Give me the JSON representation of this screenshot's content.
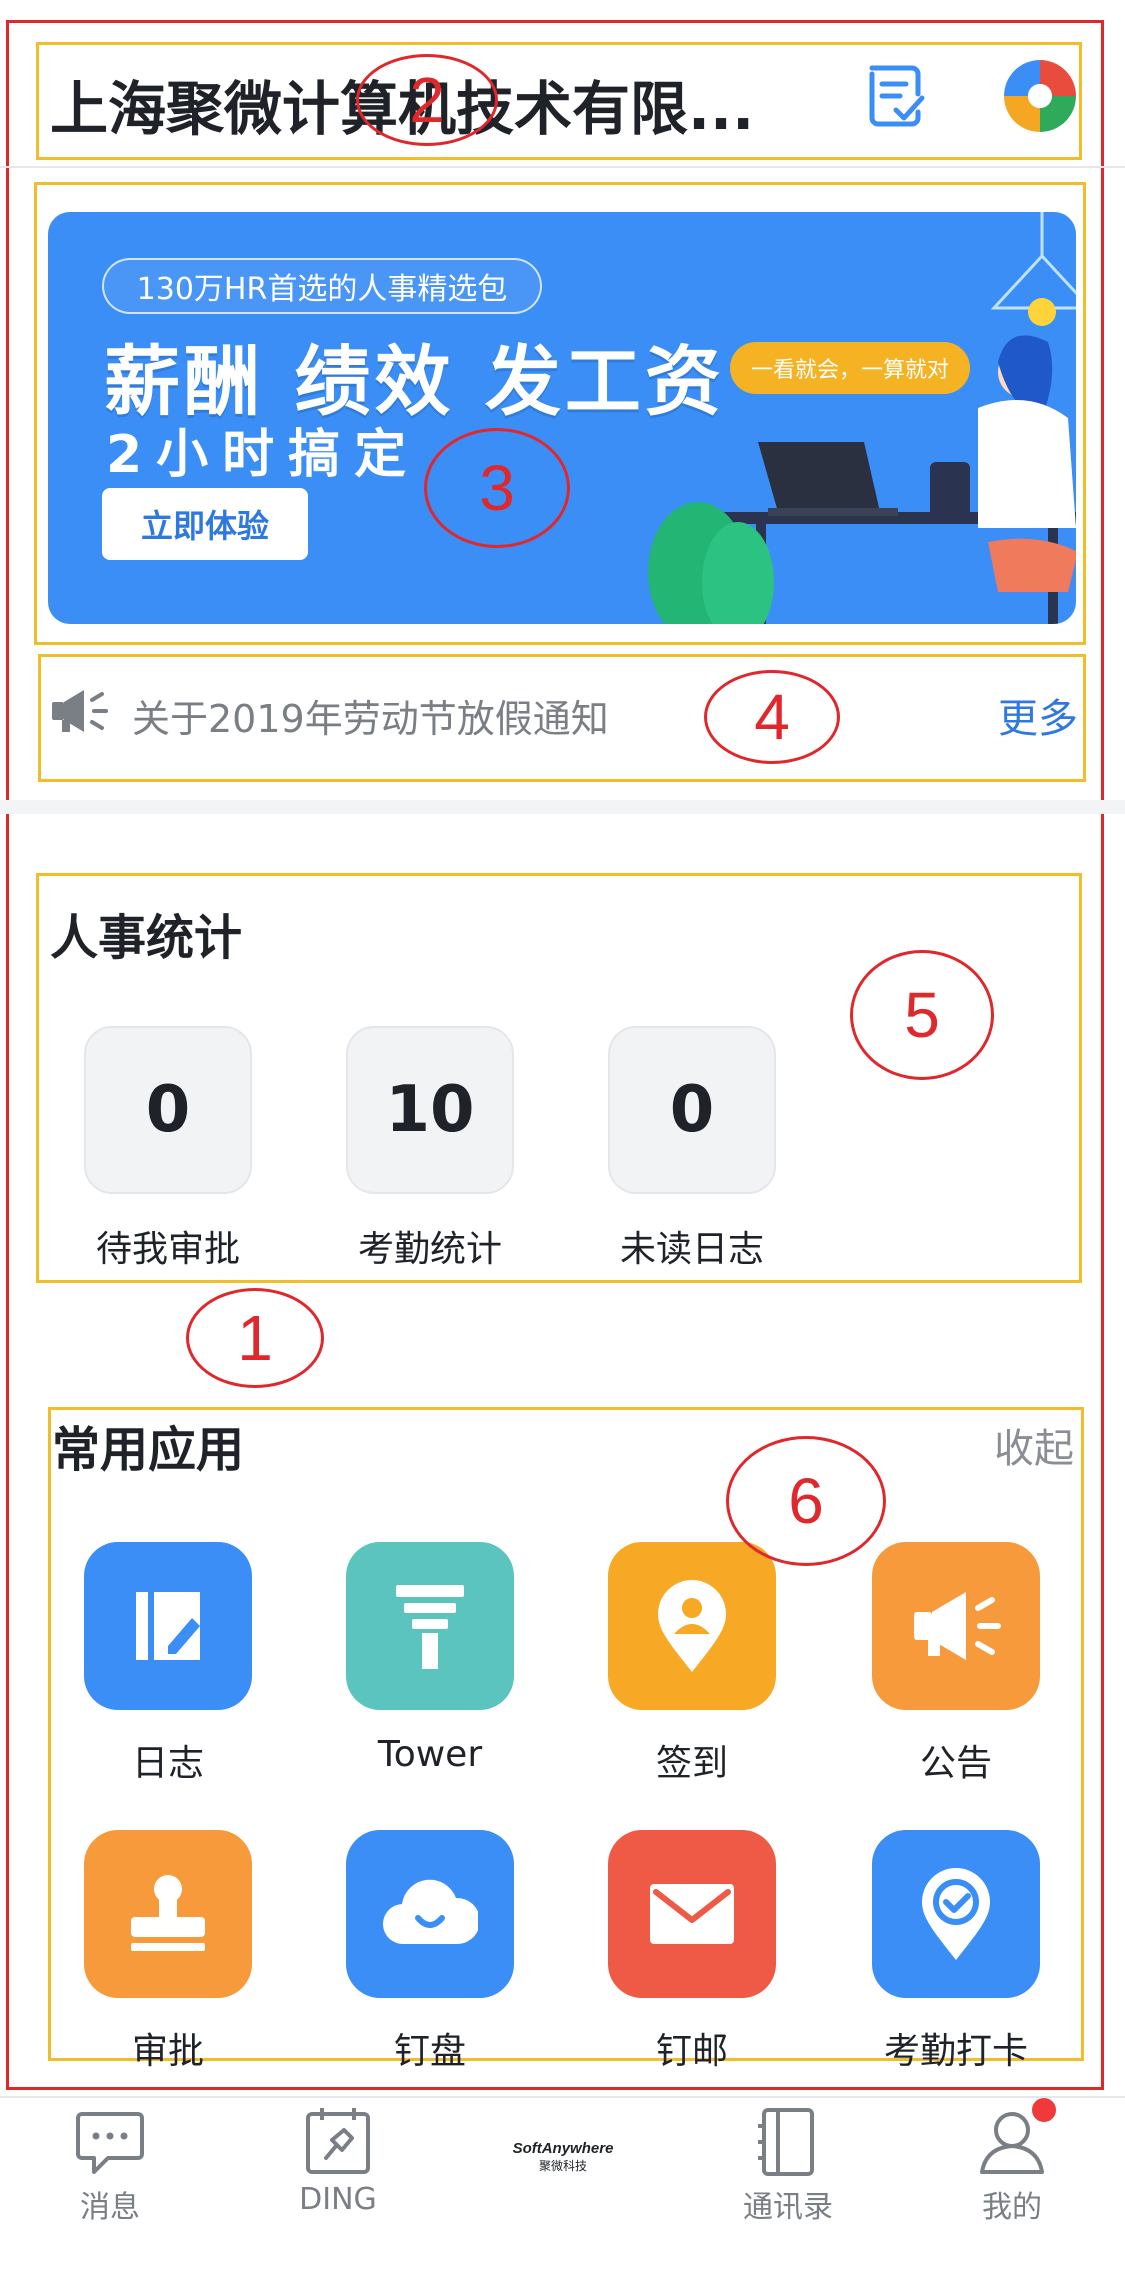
{
  "header": {
    "company_title": "上海聚微计算机技术有限...",
    "edit_icon": "edit-check-icon",
    "avatar_icon": "colorful-logo-icon"
  },
  "banner": {
    "tag": "130万HR首选的人事精选包",
    "headline": "薪酬 绩效 发工资",
    "subline": "2小时搞定",
    "cta": "立即体验",
    "bubble": "一看就会，一算就对"
  },
  "notice": {
    "icon": "megaphone-icon",
    "text": "关于2019年劳动节放假通知",
    "more": "更多"
  },
  "hr_stats": {
    "title": "人事统计",
    "items": [
      {
        "value": "0",
        "label": "待我审批"
      },
      {
        "value": "10",
        "label": "考勤统计"
      },
      {
        "value": "0",
        "label": "未读日志"
      }
    ]
  },
  "apps": {
    "title": "常用应用",
    "collapse": "收起",
    "items": [
      {
        "label": "日志",
        "icon": "journal-icon",
        "color": "#3a8ef6"
      },
      {
        "label": "Tower",
        "icon": "tower-icon",
        "color": "#5cc4bf"
      },
      {
        "label": "签到",
        "icon": "location-person-icon",
        "color": "#f7a824"
      },
      {
        "label": "公告",
        "icon": "megaphone-icon",
        "color": "#f79a3c"
      },
      {
        "label": "审批",
        "icon": "stamp-icon",
        "color": "#f79a3c"
      },
      {
        "label": "钉盘",
        "icon": "cloud-icon",
        "color": "#3a8ef6"
      },
      {
        "label": "钉邮",
        "icon": "mail-icon",
        "color": "#ef5a46"
      },
      {
        "label": "考勤打卡",
        "icon": "location-check-icon",
        "color": "#3a8ef6"
      }
    ]
  },
  "tabbar": {
    "items": [
      {
        "label": "消息",
        "icon": "chat-bubble-icon"
      },
      {
        "label": "DING",
        "icon": "calendar-pin-icon"
      },
      {
        "label": "",
        "icon": "softanywhere-logo"
      },
      {
        "label": "通讯录",
        "icon": "address-book-icon"
      },
      {
        "label": "我的",
        "icon": "person-icon"
      }
    ],
    "logo_text": "SoftAnywhere",
    "logo_sub": "聚微科技"
  },
  "annotations": [
    "1",
    "2",
    "3",
    "4",
    "5",
    "6"
  ]
}
